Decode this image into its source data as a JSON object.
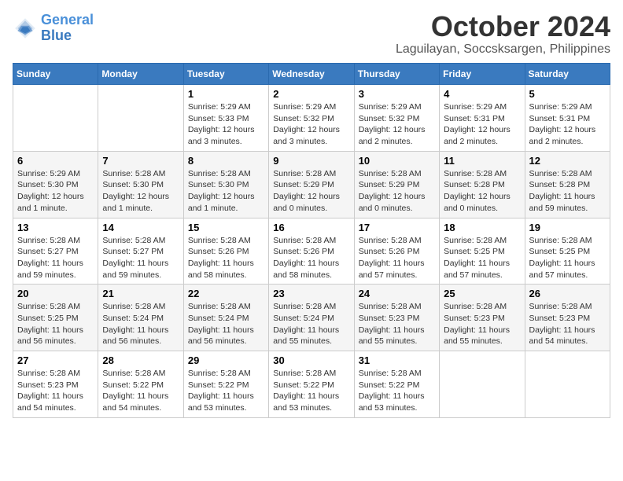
{
  "logo": {
    "line1": "General",
    "line2": "Blue"
  },
  "title": "October 2024",
  "location": "Laguilayan, Soccsksargen, Philippines",
  "weekdays": [
    "Sunday",
    "Monday",
    "Tuesday",
    "Wednesday",
    "Thursday",
    "Friday",
    "Saturday"
  ],
  "weeks": [
    [
      {
        "day": "",
        "info": ""
      },
      {
        "day": "",
        "info": ""
      },
      {
        "day": "1",
        "sunrise": "5:29 AM",
        "sunset": "5:33 PM",
        "daylight": "12 hours and 3 minutes."
      },
      {
        "day": "2",
        "sunrise": "5:29 AM",
        "sunset": "5:32 PM",
        "daylight": "12 hours and 3 minutes."
      },
      {
        "day": "3",
        "sunrise": "5:29 AM",
        "sunset": "5:32 PM",
        "daylight": "12 hours and 2 minutes."
      },
      {
        "day": "4",
        "sunrise": "5:29 AM",
        "sunset": "5:31 PM",
        "daylight": "12 hours and 2 minutes."
      },
      {
        "day": "5",
        "sunrise": "5:29 AM",
        "sunset": "5:31 PM",
        "daylight": "12 hours and 2 minutes."
      }
    ],
    [
      {
        "day": "6",
        "sunrise": "5:29 AM",
        "sunset": "5:30 PM",
        "daylight": "12 hours and 1 minute."
      },
      {
        "day": "7",
        "sunrise": "5:28 AM",
        "sunset": "5:30 PM",
        "daylight": "12 hours and 1 minute."
      },
      {
        "day": "8",
        "sunrise": "5:28 AM",
        "sunset": "5:30 PM",
        "daylight": "12 hours and 1 minute."
      },
      {
        "day": "9",
        "sunrise": "5:28 AM",
        "sunset": "5:29 PM",
        "daylight": "12 hours and 0 minutes."
      },
      {
        "day": "10",
        "sunrise": "5:28 AM",
        "sunset": "5:29 PM",
        "daylight": "12 hours and 0 minutes."
      },
      {
        "day": "11",
        "sunrise": "5:28 AM",
        "sunset": "5:28 PM",
        "daylight": "12 hours and 0 minutes."
      },
      {
        "day": "12",
        "sunrise": "5:28 AM",
        "sunset": "5:28 PM",
        "daylight": "11 hours and 59 minutes."
      }
    ],
    [
      {
        "day": "13",
        "sunrise": "5:28 AM",
        "sunset": "5:27 PM",
        "daylight": "11 hours and 59 minutes."
      },
      {
        "day": "14",
        "sunrise": "5:28 AM",
        "sunset": "5:27 PM",
        "daylight": "11 hours and 59 minutes."
      },
      {
        "day": "15",
        "sunrise": "5:28 AM",
        "sunset": "5:26 PM",
        "daylight": "11 hours and 58 minutes."
      },
      {
        "day": "16",
        "sunrise": "5:28 AM",
        "sunset": "5:26 PM",
        "daylight": "11 hours and 58 minutes."
      },
      {
        "day": "17",
        "sunrise": "5:28 AM",
        "sunset": "5:26 PM",
        "daylight": "11 hours and 57 minutes."
      },
      {
        "day": "18",
        "sunrise": "5:28 AM",
        "sunset": "5:25 PM",
        "daylight": "11 hours and 57 minutes."
      },
      {
        "day": "19",
        "sunrise": "5:28 AM",
        "sunset": "5:25 PM",
        "daylight": "11 hours and 57 minutes."
      }
    ],
    [
      {
        "day": "20",
        "sunrise": "5:28 AM",
        "sunset": "5:25 PM",
        "daylight": "11 hours and 56 minutes."
      },
      {
        "day": "21",
        "sunrise": "5:28 AM",
        "sunset": "5:24 PM",
        "daylight": "11 hours and 56 minutes."
      },
      {
        "day": "22",
        "sunrise": "5:28 AM",
        "sunset": "5:24 PM",
        "daylight": "11 hours and 56 minutes."
      },
      {
        "day": "23",
        "sunrise": "5:28 AM",
        "sunset": "5:24 PM",
        "daylight": "11 hours and 55 minutes."
      },
      {
        "day": "24",
        "sunrise": "5:28 AM",
        "sunset": "5:23 PM",
        "daylight": "11 hours and 55 minutes."
      },
      {
        "day": "25",
        "sunrise": "5:28 AM",
        "sunset": "5:23 PM",
        "daylight": "11 hours and 55 minutes."
      },
      {
        "day": "26",
        "sunrise": "5:28 AM",
        "sunset": "5:23 PM",
        "daylight": "11 hours and 54 minutes."
      }
    ],
    [
      {
        "day": "27",
        "sunrise": "5:28 AM",
        "sunset": "5:23 PM",
        "daylight": "11 hours and 54 minutes."
      },
      {
        "day": "28",
        "sunrise": "5:28 AM",
        "sunset": "5:22 PM",
        "daylight": "11 hours and 54 minutes."
      },
      {
        "day": "29",
        "sunrise": "5:28 AM",
        "sunset": "5:22 PM",
        "daylight": "11 hours and 53 minutes."
      },
      {
        "day": "30",
        "sunrise": "5:28 AM",
        "sunset": "5:22 PM",
        "daylight": "11 hours and 53 minutes."
      },
      {
        "day": "31",
        "sunrise": "5:28 AM",
        "sunset": "5:22 PM",
        "daylight": "11 hours and 53 minutes."
      },
      {
        "day": "",
        "info": ""
      },
      {
        "day": "",
        "info": ""
      }
    ]
  ]
}
